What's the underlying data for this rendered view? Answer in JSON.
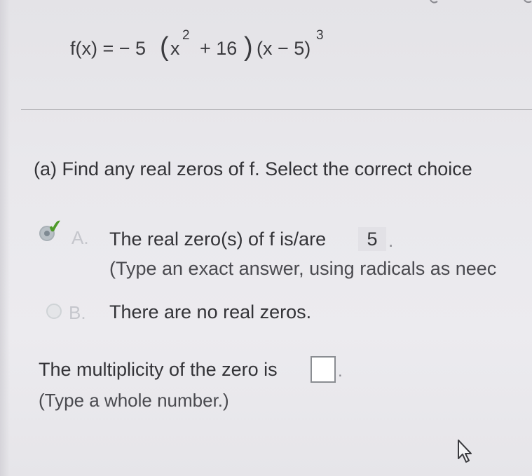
{
  "formula": {
    "lhs": "f(x) = − 5",
    "open_paren": "(",
    "x": "x",
    "x_exp": "2",
    "plus16": "+ 16",
    "close_paren": ")",
    "factor2": "(x − 5)",
    "factor2_exp": "3"
  },
  "question": {
    "text": "(a) Find any real zeros of f. Select the correct choice"
  },
  "options": [
    {
      "letter": "A.",
      "text": "The real zero(s) of f is/are",
      "answer": "5",
      "answer_suffix": ".",
      "hint": "(Type an exact answer, using radicals as neec",
      "selected": true,
      "check_icon": "check-icon"
    },
    {
      "letter": "B.",
      "text": "There are no real zeros.",
      "selected": false
    }
  ],
  "multiplicity": {
    "label": "The multiplicity of the zero is",
    "value": "",
    "suffix": ".",
    "hint": "(Type a whole number.)"
  },
  "colors": {
    "check_green": "#4f9a2a",
    "text": "#333337",
    "background": "#e9e8ec"
  },
  "icons": {
    "cursor": "mouse-pointer-icon",
    "check": "check-icon"
  }
}
